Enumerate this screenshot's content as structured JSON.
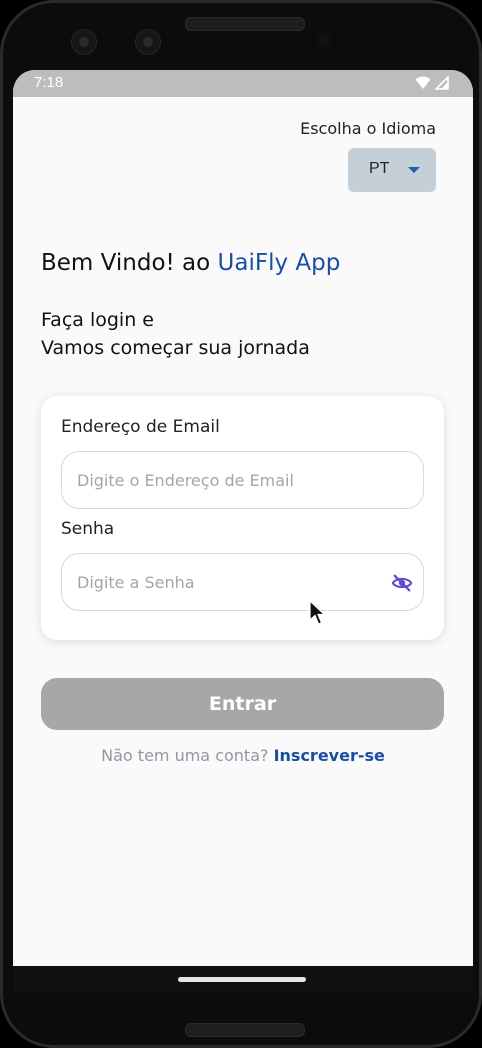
{
  "status_bar": {
    "time": "7:18",
    "icons": [
      "wifi-icon",
      "signal-icon"
    ]
  },
  "language": {
    "label": "Escolha o Idioma",
    "selected": "PT"
  },
  "welcome": {
    "prefix": "Bem Vindo! ao ",
    "brand": "UaiFly App"
  },
  "subtitle": {
    "line1": "Faça login e",
    "line2": "Vamos começar sua jornada"
  },
  "form": {
    "email_label": "Endereço de Email",
    "email_placeholder": "Digite o Endereço de Email",
    "email_value": "",
    "password_label": "Senha",
    "password_placeholder": "Digite a Senha",
    "password_value": ""
  },
  "actions": {
    "submit_label": "Entrar",
    "signup_prompt": "Não tem uma conta? ",
    "signup_link": "Inscrever-se"
  },
  "colors": {
    "brand": "#1a4fa0",
    "button_disabled": "#a7a7a7",
    "eye_icon": "#5b4bd6",
    "status_bar": "#bdbdbd"
  }
}
